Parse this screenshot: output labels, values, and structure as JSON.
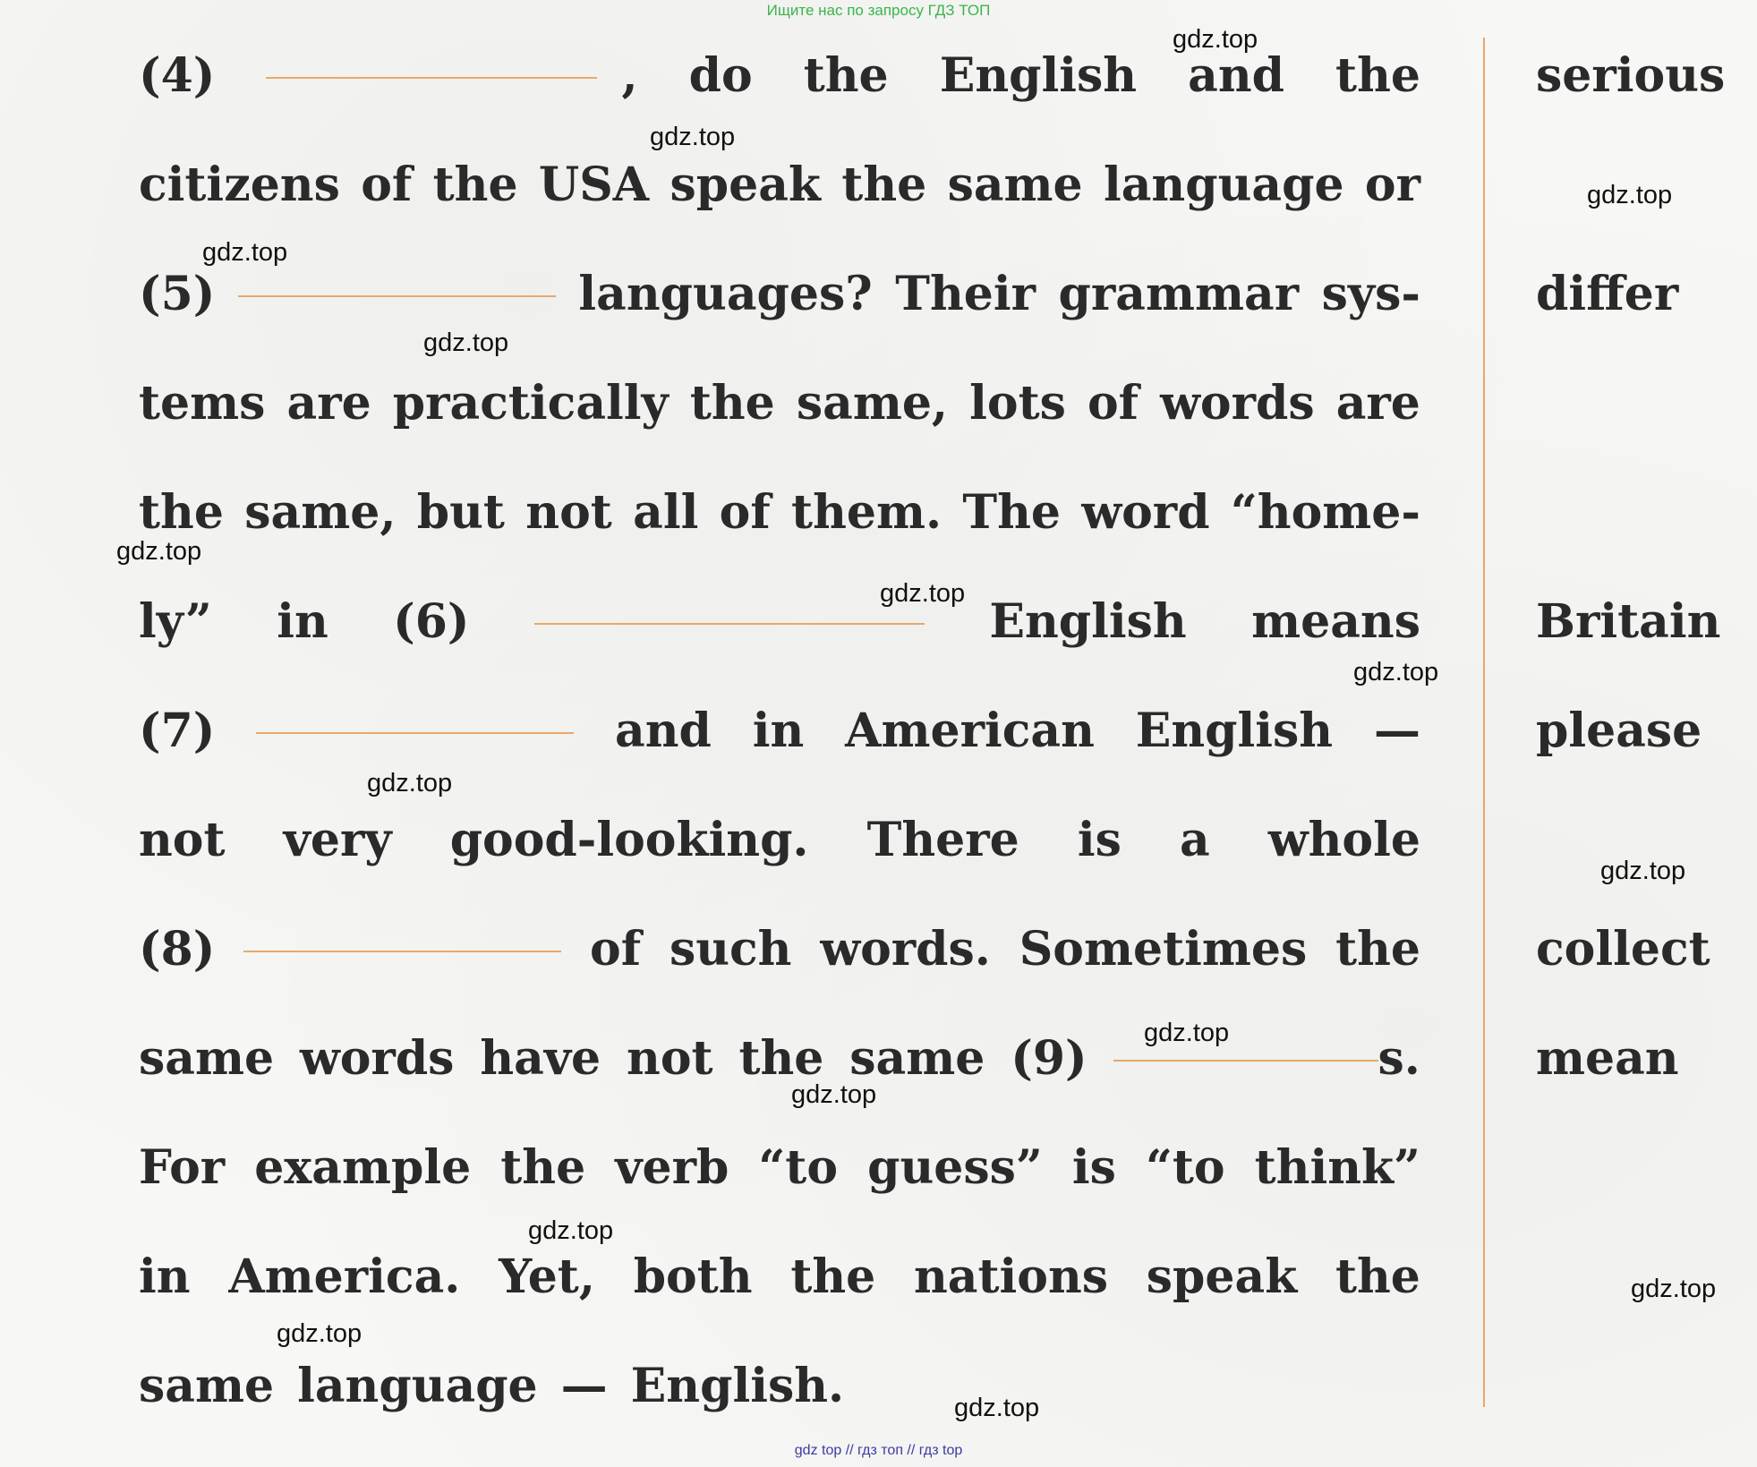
{
  "header_note": "Ищите нас по запросу ГДЗ ТОП",
  "footer_note": "gdz top  //  гдз топ  //  гдз top",
  "watermark": "gdz.top",
  "lines": [
    [
      "(4)",
      "{blank}",
      ",",
      "do",
      "the",
      "English",
      "and",
      "the"
    ],
    [
      "citizens",
      "of",
      "the",
      "USA",
      "speak",
      "the",
      "same",
      "language",
      "or"
    ],
    [
      "(5)",
      "{blank}",
      "languages?",
      "Their",
      "grammar",
      "sys-"
    ],
    [
      "tems",
      "are",
      "practically",
      "the",
      "same,",
      "lots",
      "of",
      "words",
      "are"
    ],
    [
      "the",
      "same,",
      "but",
      "not",
      "all",
      "of",
      "them.",
      "The",
      "word",
      "“home-"
    ],
    [
      "ly”",
      "in",
      "(6)",
      "{blank}",
      "English",
      "means"
    ],
    [
      "(7)",
      "{blank}",
      "and",
      "in",
      "American",
      "English",
      "—"
    ],
    [
      "not",
      "very",
      "good-looking.",
      "There",
      "is",
      "a",
      "whole"
    ],
    [
      "(8)",
      "{blank}",
      "of",
      "such",
      "words.",
      "Sometimes",
      "the"
    ],
    [
      "same",
      "words",
      "have",
      "not",
      "the",
      "same",
      "(9)",
      "{blank}s."
    ],
    [
      "For",
      "example",
      "the",
      "verb",
      "“to",
      "guess”",
      "is",
      "“to",
      "think”"
    ],
    [
      "in",
      "America.",
      "Yet,",
      "both",
      "the",
      "nations",
      "speak",
      "the"
    ],
    [
      "same",
      "language",
      "—",
      "English."
    ]
  ],
  "hints": [
    "serious",
    "differ",
    "Britain",
    "please",
    "collect",
    "mean"
  ]
}
